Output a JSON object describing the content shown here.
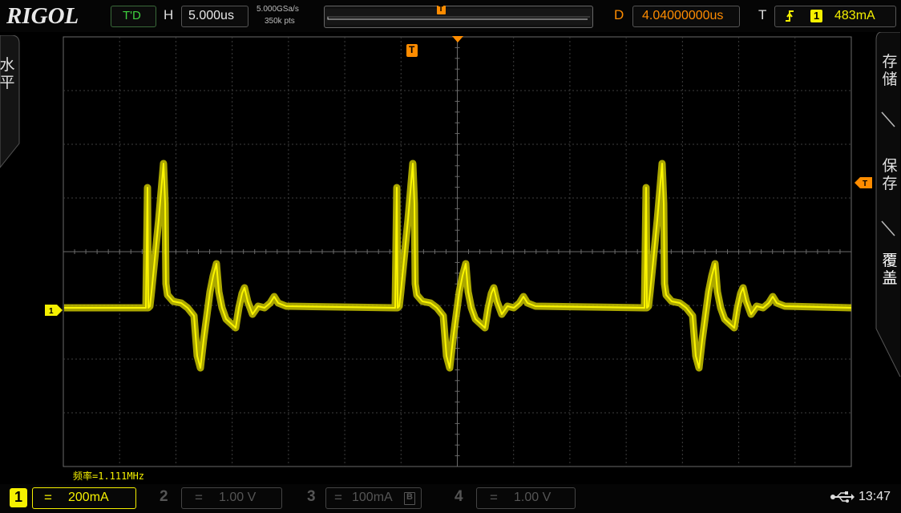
{
  "brand": "RIGOL",
  "top": {
    "trig_status": "T'D",
    "horizontal_label": "H",
    "timebase": "5.000us",
    "sample_rate": "5.000GSa/s",
    "memory_depth": "350k pts",
    "delay_label": "D",
    "delay_value": "4.04000000us",
    "trigger_label": "T",
    "trigger_channel": "1",
    "trigger_level": "483mA",
    "trigger_slope_icon": "rising-edge-icon"
  },
  "markers": {
    "trigger_pos_top": "T",
    "trigger_level_right": "T",
    "channel1_ground": "1"
  },
  "left_menu": {
    "label_line1": "水",
    "label_line2": "平"
  },
  "right_menu": {
    "items": [
      {
        "line1": "存",
        "line2": "储"
      },
      {
        "line1": "保",
        "line2": "存"
      },
      {
        "line1": "覆",
        "line2": "盖"
      }
    ]
  },
  "measurement": "频率=1.111MHz",
  "channels": [
    {
      "num": "1",
      "coupling": "=",
      "scale": "200mA",
      "active": true
    },
    {
      "num": "2",
      "coupling": "=",
      "scale": "1.00 V",
      "active": false
    },
    {
      "num": "3",
      "coupling": "=",
      "scale": "100mA",
      "active": false,
      "badge": "B"
    },
    {
      "num": "4",
      "coupling": "=",
      "scale": "1.00 V",
      "active": false
    }
  ],
  "status": {
    "usb_icon": "usb-icon",
    "time": "13:47"
  },
  "colors": {
    "ch1": "#f5f000",
    "orange": "#ff8c00",
    "grid": "#444444",
    "bg": "#000000"
  }
}
